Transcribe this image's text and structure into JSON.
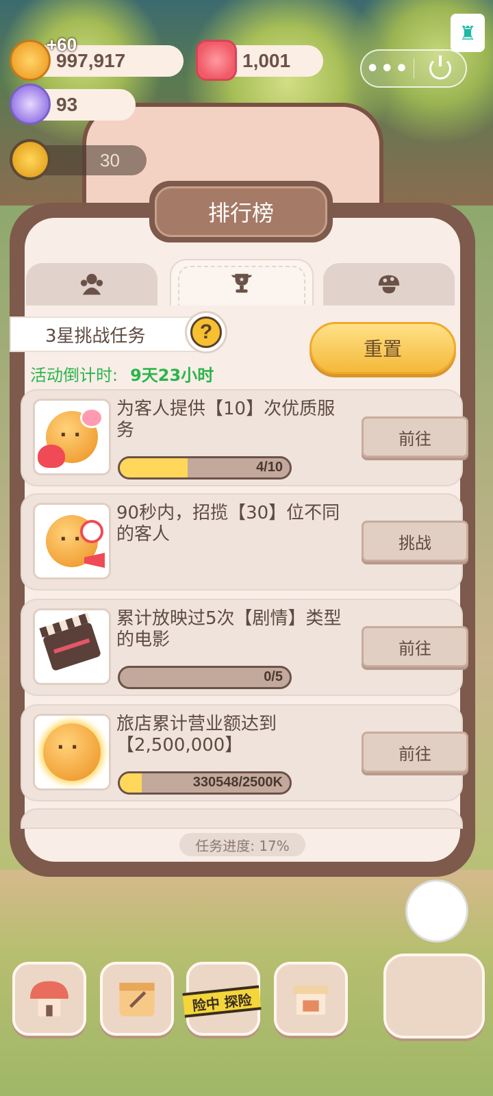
{
  "resources": {
    "coins": "997,917",
    "coins_gain": "+60",
    "gems": "1,001",
    "crystals": "93",
    "sun_points": "30"
  },
  "header": {
    "more_label": "•••"
  },
  "panel": {
    "title": "排行榜",
    "mission_title": "3星挑战任务",
    "help_label": "?",
    "reset_label": "重置",
    "countdown_label": "活动倒计时:",
    "countdown_value": "9天23小时",
    "footer_progress": "任务进度: 17%"
  },
  "tabs": [
    {
      "icon": "crowd-icon"
    },
    {
      "icon": "trophy-icon"
    },
    {
      "icon": "mushroom-icon"
    }
  ],
  "tasks": [
    {
      "desc": "为客人提供【10】次优质服务",
      "button": "前往",
      "progress_text": "4/10",
      "progress": 0.4,
      "icon": "cookie-heart-icon"
    },
    {
      "desc": "90秒内，招揽【30】位不同的客人",
      "button": "挑战",
      "progress_text": "",
      "progress": null,
      "icon": "cookie-megaphone-icon"
    },
    {
      "desc": "累计放映过5次【剧情】类型的电影",
      "button": "前往",
      "progress_text": "0/5",
      "progress": 0.0,
      "icon": "clapperboard-icon"
    },
    {
      "desc": "旅店累计营业额达到【2,500,000】",
      "button": "前往",
      "progress_text": "330548/2500K",
      "progress": 0.13,
      "icon": "golden-cookie-icon"
    }
  ],
  "bottom_nav": {
    "adventure_label": "险中 探险"
  },
  "colors": {
    "panel_border": "#7d5a4b",
    "panel_bg": "#f8ede7",
    "accent_yellow": "#f4b93a",
    "countdown_green": "#2ab54a",
    "progress_fill": "#ffd75a"
  }
}
